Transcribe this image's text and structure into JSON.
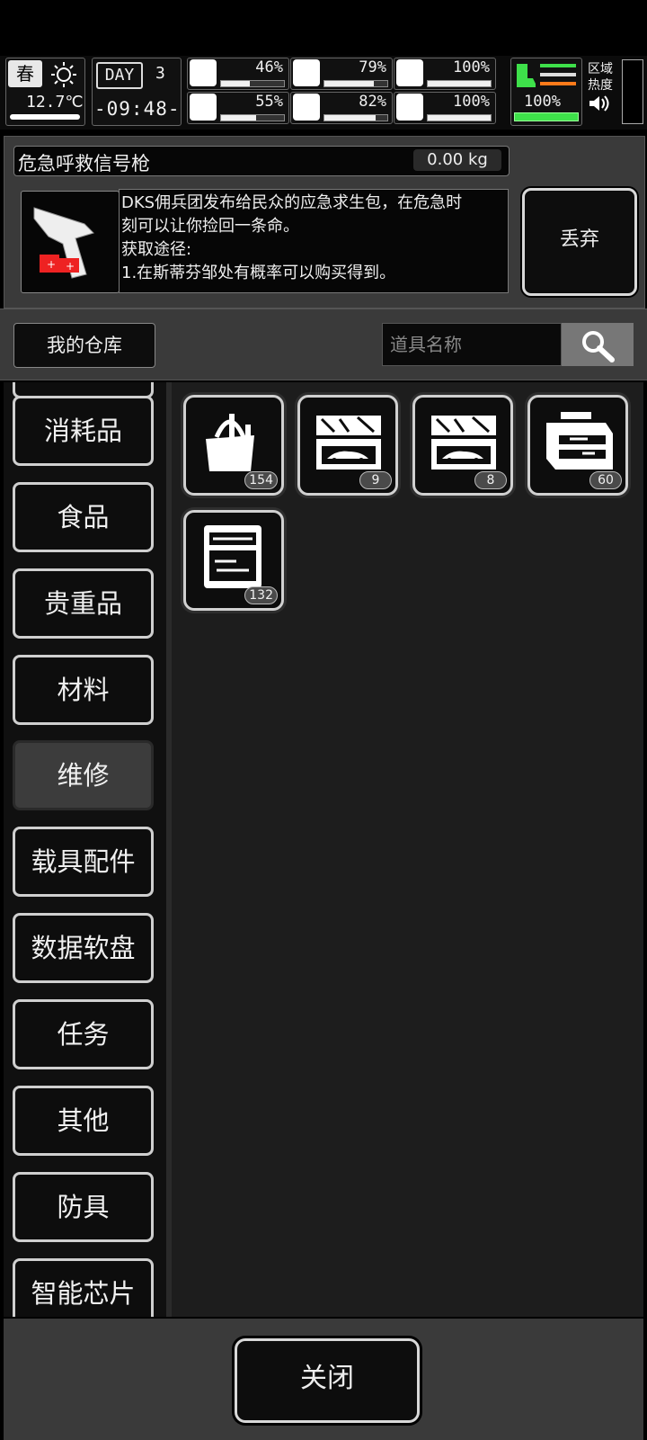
{
  "hud": {
    "season": "春",
    "temperature": "12.7℃",
    "day_label": "DAY",
    "day_number": "3",
    "time": "-09:48-",
    "stats": [
      {
        "icon": "medkit-icon",
        "value": "46%",
        "level": 0.46
      },
      {
        "icon": "stomach-icon",
        "value": "79%",
        "level": 0.79
      },
      {
        "icon": "pill-icon",
        "value": "100%",
        "level": 1.0
      },
      {
        "icon": "brain-icon",
        "value": "55%",
        "level": 0.55
      },
      {
        "icon": "water-drop-icon",
        "value": "82%",
        "level": 0.82
      },
      {
        "icon": "heart-icon",
        "value": "100%",
        "level": 1.0
      }
    ],
    "boot_value": "100%",
    "zone_heat_label_1": "区域",
    "zone_heat_label_2": "热度",
    "accent_green": "#3ee04a",
    "accent_orange": "#ff7a1a"
  },
  "detail": {
    "item_name": "危急呼救信号枪",
    "weight": "0.00 kg",
    "description_lines": [
      "DKS佣兵团发布给民众的应急求生包，在危急时",
      "刻可以让你捡回一条命。",
      "获取途径:",
      "1.在斯蒂芬邹处有概率可以购买得到。"
    ],
    "drop_label": "丢弃"
  },
  "warehouse": {
    "label": "我的仓库",
    "search_placeholder": "道具名称"
  },
  "categories": [
    {
      "label": "消耗品"
    },
    {
      "label": "食品"
    },
    {
      "label": "贵重品"
    },
    {
      "label": "材料"
    },
    {
      "label": "维修",
      "active": true
    },
    {
      "label": "载具配件"
    },
    {
      "label": "数据软盘"
    },
    {
      "label": "任务"
    },
    {
      "label": "其他"
    },
    {
      "label": "防具"
    },
    {
      "label": "智能芯片"
    }
  ],
  "items": [
    {
      "name": "tool-bag-icon",
      "count": "154"
    },
    {
      "name": "car-repair-kit-icon",
      "count": "9"
    },
    {
      "name": "car-repair-kit-icon",
      "count": "8"
    },
    {
      "name": "tool-chest-icon",
      "count": "60"
    },
    {
      "name": "precision-tool-case-icon",
      "count": "132"
    }
  ],
  "close_label": "关闭"
}
